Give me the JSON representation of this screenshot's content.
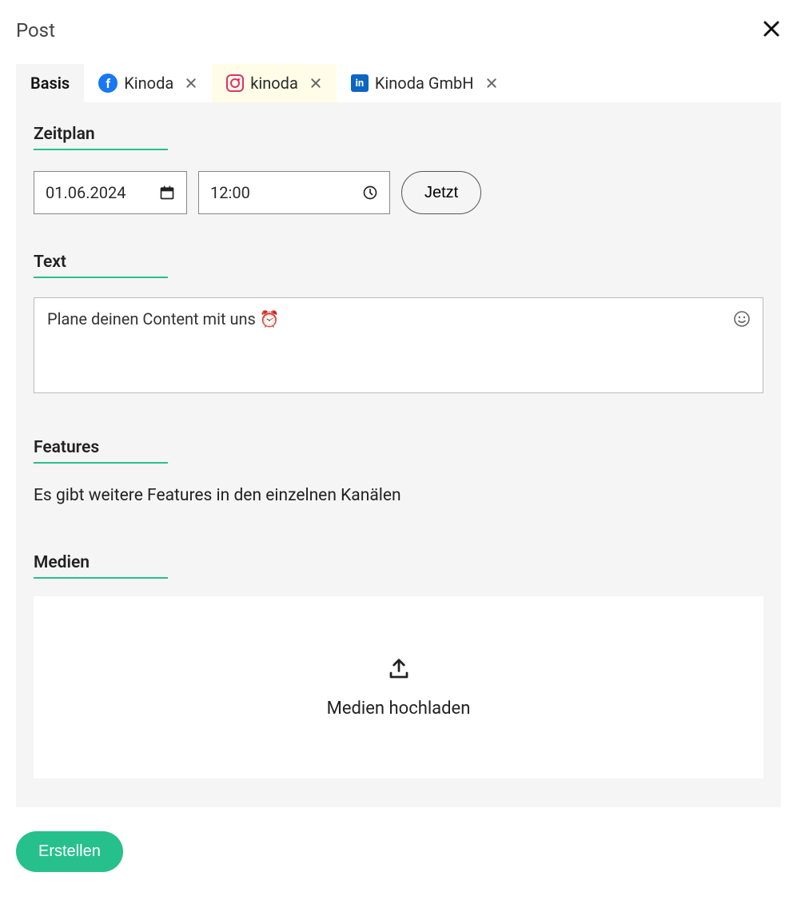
{
  "header": {
    "title": "Post"
  },
  "tabs": {
    "basis": "Basis",
    "facebook": "Kinoda",
    "instagram": "kinoda",
    "linkedin": "Kinoda GmbH"
  },
  "sections": {
    "schedule": {
      "heading": "Zeitplan",
      "date": "01.06.2024",
      "time": "12:00",
      "now": "Jetzt"
    },
    "text": {
      "heading": "Text",
      "content": "Plane deinen Content mit uns ⏰"
    },
    "features": {
      "heading": "Features",
      "info": "Es gibt weitere Features in den einzelnen Kanälen"
    },
    "media": {
      "heading": "Medien",
      "upload": "Medien hochladen"
    }
  },
  "footer": {
    "create": "Erstellen"
  }
}
